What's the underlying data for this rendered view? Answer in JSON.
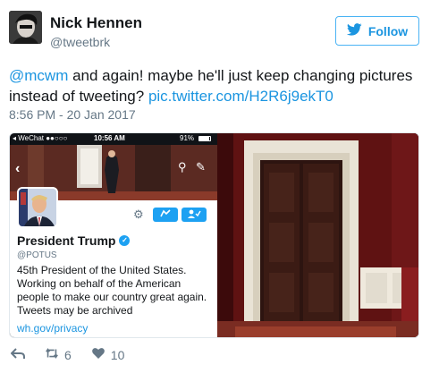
{
  "author": {
    "name": "Nick Hennen",
    "handle": "@tweetbrk"
  },
  "follow_button": {
    "label": "Follow",
    "icon": "twitter-bird-icon",
    "color": "#1b95e0"
  },
  "tweet": {
    "mention": "@mcwm",
    "text_middle": " and again! maybe he'll just keep changing pictures instead of tweeting? ",
    "link": "pic.twitter.com/H2R6j9ekT0",
    "timestamp": "8:56 PM - 20 Jan 2017"
  },
  "phone_status": {
    "carrier": "◂ WeChat ●●○○○",
    "time": "10:56 AM",
    "battery": "91%"
  },
  "profile": {
    "name": "President Trump",
    "handle": "@POTUS",
    "bio": "45th President of the United States. Working on behalf of the American people to make our country great again. Tweets may be archived",
    "url": "wh.gov/privacy"
  },
  "actions": {
    "retweets": "6",
    "likes": "10"
  },
  "colors": {
    "accent": "#1b95e0",
    "muted": "#657786",
    "verified": "#1da1f2"
  }
}
